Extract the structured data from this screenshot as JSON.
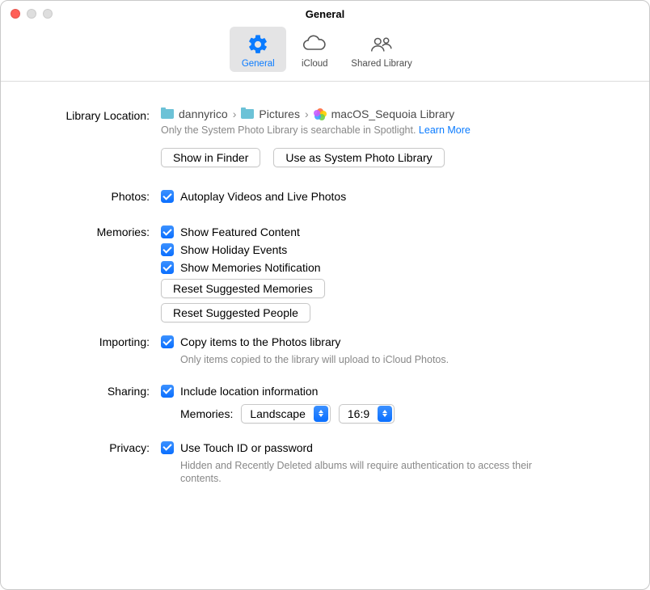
{
  "window": {
    "title": "General"
  },
  "toolbar": {
    "general": "General",
    "icloud": "iCloud",
    "shared": "Shared Library"
  },
  "library": {
    "label": "Library Location:",
    "crumb1": "dannyrico",
    "crumb2": "Pictures",
    "crumb3": "macOS_Sequoia Library",
    "note": "Only the System Photo Library is searchable in Spotlight.",
    "learn_more": "Learn More",
    "show_in_finder": "Show in Finder",
    "use_system": "Use as System Photo Library"
  },
  "photos": {
    "label": "Photos:",
    "autoplay": "Autoplay Videos and Live Photos"
  },
  "memories": {
    "label": "Memories:",
    "featured": "Show Featured Content",
    "holiday": "Show Holiday Events",
    "notification": "Show Memories Notification",
    "reset_memories": "Reset Suggested Memories",
    "reset_people": "Reset Suggested People"
  },
  "importing": {
    "label": "Importing:",
    "copy": "Copy items to the Photos library",
    "note": "Only items copied to the library will upload to iCloud Photos."
  },
  "sharing": {
    "label": "Sharing:",
    "location": "Include location information",
    "memories_label": "Memories:",
    "orientation": "Landscape",
    "aspect": "16:9"
  },
  "privacy": {
    "label": "Privacy:",
    "touchid": "Use Touch ID or password",
    "note": "Hidden and Recently Deleted albums will require authentication to access their contents."
  }
}
